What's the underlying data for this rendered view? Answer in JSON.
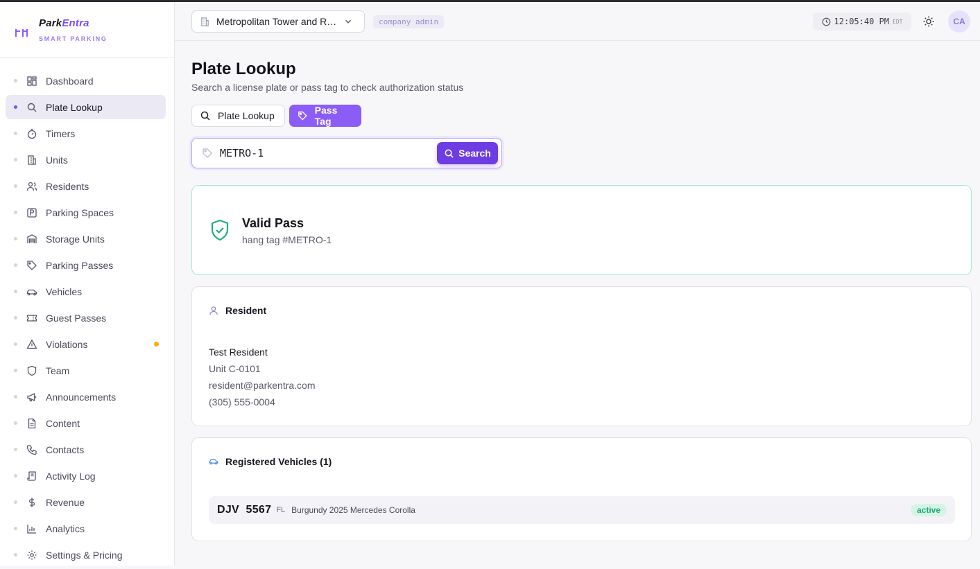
{
  "brand": {
    "name_a": "Park",
    "name_b": "Entra",
    "tagline": "SMART PARKING"
  },
  "sidebar": {
    "items": [
      {
        "label": "Dashboard",
        "icon": "dashboard-icon"
      },
      {
        "label": "Plate Lookup",
        "icon": "search-icon",
        "active": true
      },
      {
        "label": "Timers",
        "icon": "timer-icon"
      },
      {
        "label": "Units",
        "icon": "building-icon"
      },
      {
        "label": "Residents",
        "icon": "users-icon"
      },
      {
        "label": "Parking Spaces",
        "icon": "parking-icon"
      },
      {
        "label": "Storage Units",
        "icon": "warehouse-icon"
      },
      {
        "label": "Parking Passes",
        "icon": "tag-icon"
      },
      {
        "label": "Vehicles",
        "icon": "car-icon"
      },
      {
        "label": "Guest Passes",
        "icon": "ticket-icon"
      },
      {
        "label": "Violations",
        "icon": "alert-triangle-icon",
        "badge": true
      },
      {
        "label": "Team",
        "icon": "shield-icon"
      },
      {
        "label": "Announcements",
        "icon": "megaphone-icon"
      },
      {
        "label": "Content",
        "icon": "document-icon"
      },
      {
        "label": "Contacts",
        "icon": "phone-icon"
      },
      {
        "label": "Activity Log",
        "icon": "scroll-icon"
      },
      {
        "label": "Revenue",
        "icon": "dollar-icon"
      },
      {
        "label": "Analytics",
        "icon": "bar-chart-icon"
      },
      {
        "label": "Settings & Pricing",
        "icon": "gear-icon"
      }
    ]
  },
  "header": {
    "property": "Metropolitan Tower and Residences",
    "role": "company admin",
    "time": "12:05:40 PM",
    "timezone": "EDT",
    "avatar_initials": "CA"
  },
  "page": {
    "title": "Plate Lookup",
    "subtitle": "Search a license plate or pass tag to check authorization status"
  },
  "tabs": {
    "plate": "Plate Lookup",
    "pass": "Pass Tag"
  },
  "search": {
    "value": "METRO-1",
    "button": "Search"
  },
  "result": {
    "title": "Valid Pass",
    "subtitle": "hang tag #METRO-1"
  },
  "resident": {
    "heading": "Resident",
    "name": "Test Resident",
    "unit": "Unit C-0101",
    "email": "resident@parkentra.com",
    "phone": "(305) 555-0004"
  },
  "vehicles": {
    "heading": "Registered Vehicles (1)",
    "items": [
      {
        "plate": "DJV  5567",
        "state": "FL",
        "desc": "Burgundy 2025 Mercedes Corolla",
        "status": "active"
      }
    ]
  },
  "colors": {
    "accent": "#8b5cf6",
    "success": "#22b07d",
    "warning": "#f5b301"
  }
}
